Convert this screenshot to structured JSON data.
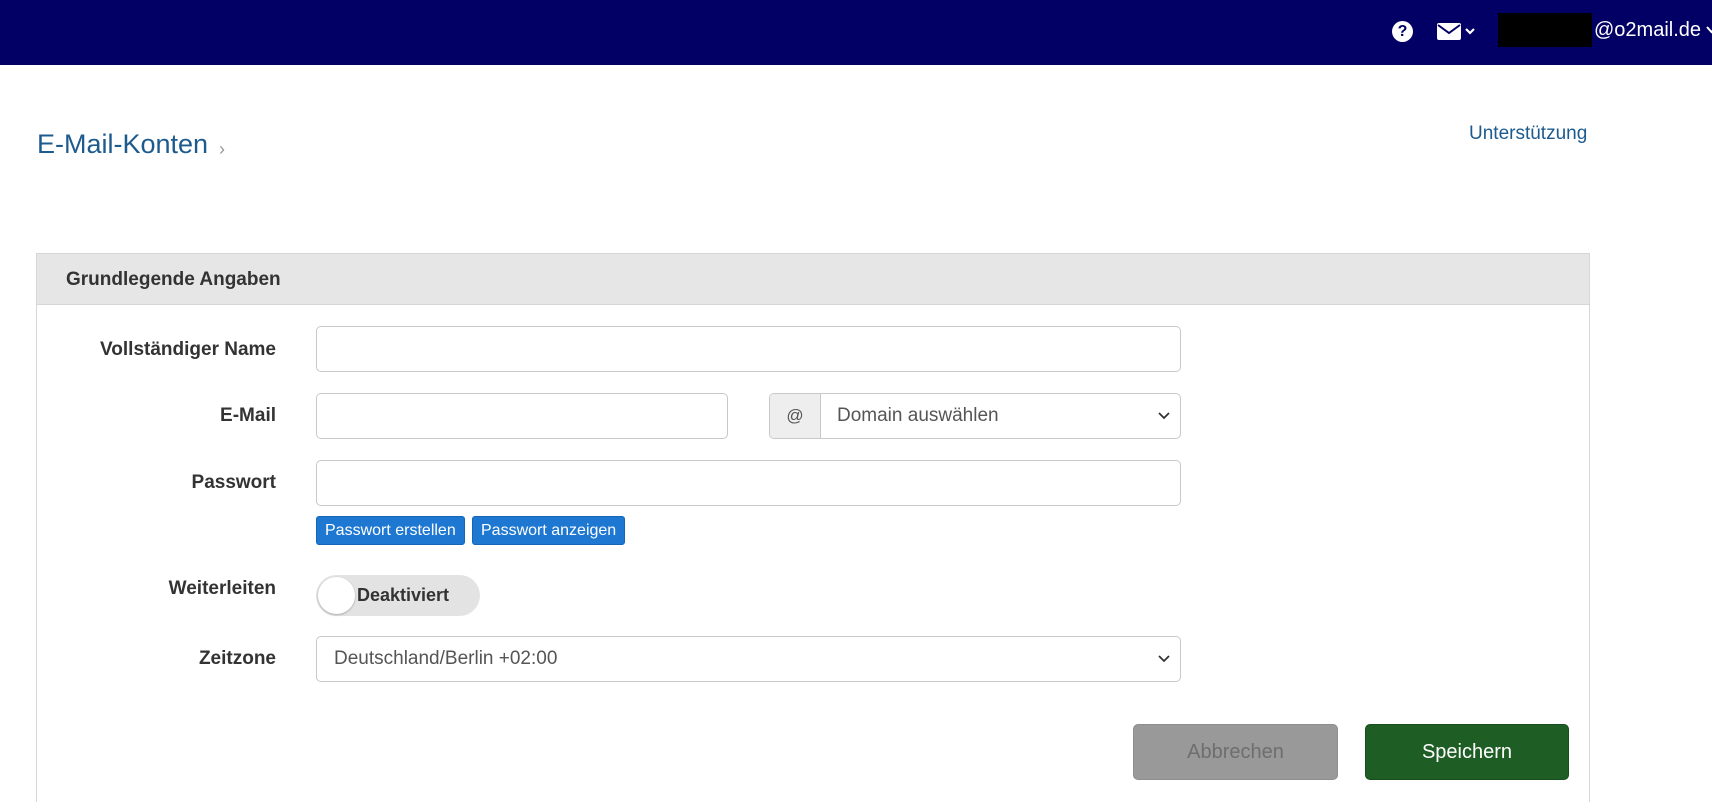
{
  "topbar": {
    "help_icon": "question-circle-icon",
    "mail_icon": "envelope-icon",
    "user_email": "@o2mail.de"
  },
  "breadcrumb": {
    "current": "E-Mail-Konten",
    "separator": "›"
  },
  "support_link": "Unterstützung",
  "panel": {
    "title": "Grundlegende Angaben"
  },
  "form": {
    "full_name": {
      "label": "Vollständiger Name",
      "value": ""
    },
    "email": {
      "label": "E-Mail",
      "value": "",
      "at_addon": "@",
      "domain_selected": "Domain auswählen"
    },
    "password": {
      "label": "Passwort",
      "value": "",
      "create_button": "Passwort erstellen",
      "show_button": "Passwort anzeigen"
    },
    "forwarding": {
      "label": "Weiterleiten",
      "state_text": "Deaktiviert",
      "enabled": false
    },
    "timezone": {
      "label": "Zeitzone",
      "selected": "Deutschland/Berlin +02:00"
    }
  },
  "actions": {
    "cancel": "Abbrechen",
    "save": "Speichern"
  },
  "colors": {
    "topbar": "#020065",
    "link": "#1d5b8f",
    "primary_small_button": "#1e78d2",
    "save_button": "#1e5e24",
    "cancel_button": "#999999"
  }
}
